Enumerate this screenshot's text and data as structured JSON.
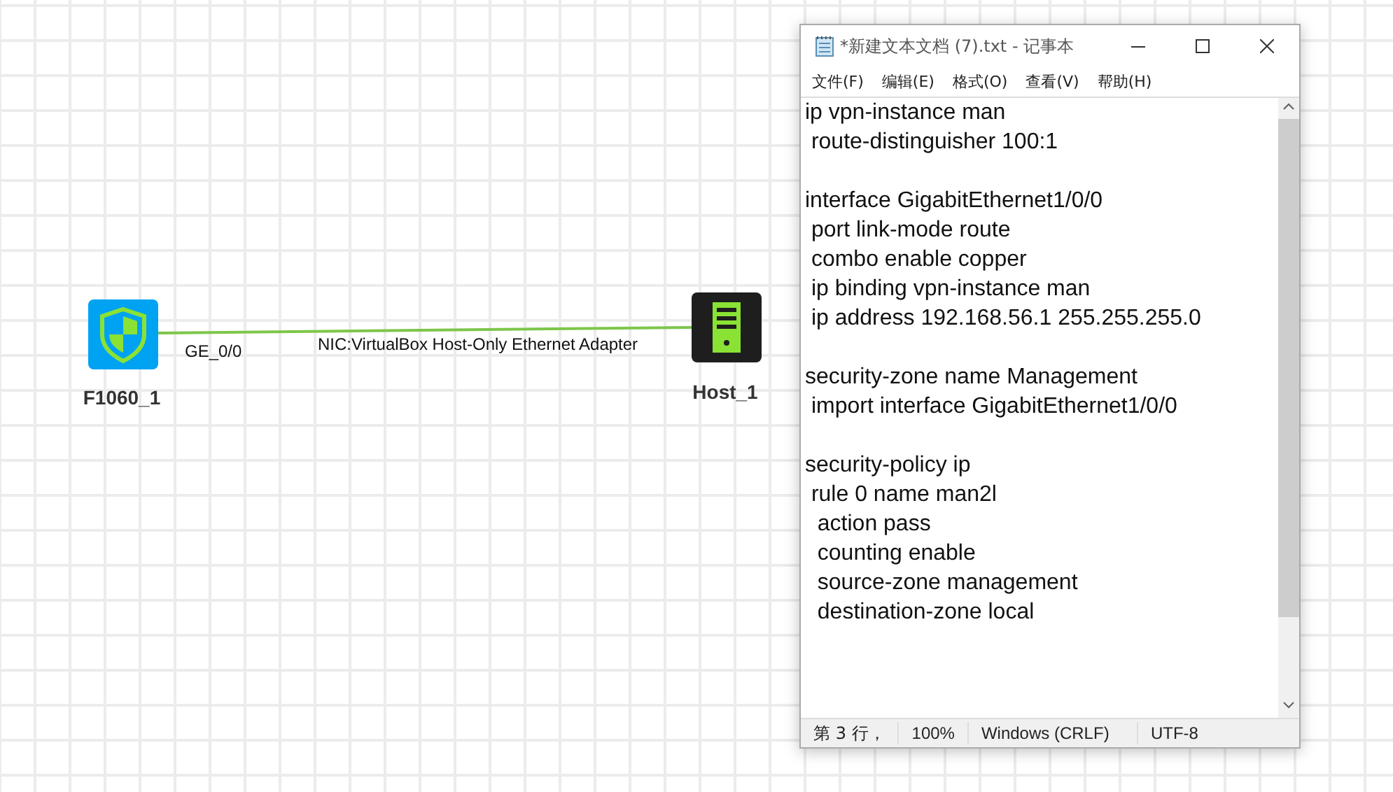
{
  "topology": {
    "nodes": [
      {
        "kind": "firewall",
        "label": "F1060_1"
      },
      {
        "kind": "host",
        "label": "Host_1"
      }
    ],
    "link": {
      "port_a": "GE_0/0",
      "port_b": "NIC:VirtualBox Host-Only Ethernet Adapter"
    }
  },
  "notepad": {
    "title": "*新建文本文档 (7).txt - 记事本",
    "menu": [
      "文件(F)",
      "编辑(E)",
      "格式(O)",
      "查看(V)",
      "帮助(H)"
    ],
    "text": "ip vpn-instance man\n route-distinguisher 100:1\n\ninterface GigabitEthernet1/0/0\n port link-mode route\n combo enable copper\n ip binding vpn-instance man\n ip address 192.168.56.1 255.255.255.0\n\nsecurity-zone name Management\n import interface GigabitEthernet1/0/0\n\nsecurity-policy ip\n rule 0 name man2l\n  action pass\n  counting enable\n  source-zone management\n  destination-zone local",
    "status_bar": [
      "第 3 行，",
      "100%",
      "Windows (CRLF)",
      "UTF-8"
    ]
  }
}
